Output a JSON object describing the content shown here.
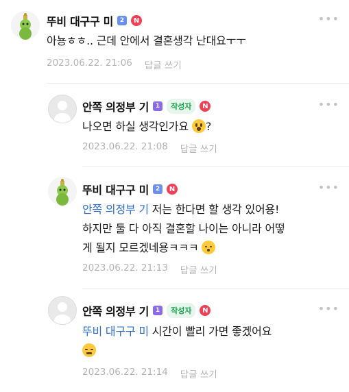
{
  "comments": [
    {
      "author": "뚜비 대구구 미",
      "level_badge": "2",
      "new_badge": "N",
      "text": "아뇽ㅎㅎ.. 근데 안에서 결혼생각 난대요ㅜㅜ",
      "date": "2023.06.22. 21:06",
      "reply_label": "답글 쓰기",
      "avatar_icon": "teletubby-avatar-icon"
    },
    {
      "author": "안쪽 의정부 기",
      "level_badge": "1",
      "writer_badge": "작성자",
      "new_badge": "N",
      "text": "나오면 하실 생각인가요",
      "emoji": "surprised-face-emoji",
      "text_after": "?",
      "date": "2023.06.22. 21:08",
      "reply_label": "답글 쓰기",
      "avatar_icon": "default-profile-icon"
    },
    {
      "author": "뚜비 대구구 미",
      "level_badge": "2",
      "new_badge": "N",
      "mention": "안쪽 의정부 기",
      "text_line1": " 저는 한다면 할 생각 있어용!",
      "text_line2": "하지만 둘 다 아직 결혼할 나이는 아니라 어떻",
      "text_line3": "게 될지 모르겠네용ㅋㅋㅋ",
      "emoji": "kissing-face-emoji",
      "date": "2023.06.22. 21:13",
      "reply_label": "답글 쓰기",
      "avatar_icon": "teletubby-avatar-icon"
    },
    {
      "author": "안쪽 의정부 기",
      "level_badge": "1",
      "writer_badge": "작성자",
      "new_badge": "N",
      "mention": "뚜비 대구구 미",
      "text": " 시간이 빨리 가면 좋겠어요",
      "emoji": "confounded-face-emoji",
      "date": "2023.06.22. 21:14",
      "reply_label": "답글 쓰기",
      "avatar_icon": "default-profile-icon"
    }
  ],
  "more_label": "•••",
  "colors": {
    "mention": "#2f6fd3",
    "meta": "#b3b3b3",
    "writer_badge_bg": "#e6f6ec",
    "writer_badge_text": "#17a24a",
    "new_badge": "#ef4055"
  }
}
